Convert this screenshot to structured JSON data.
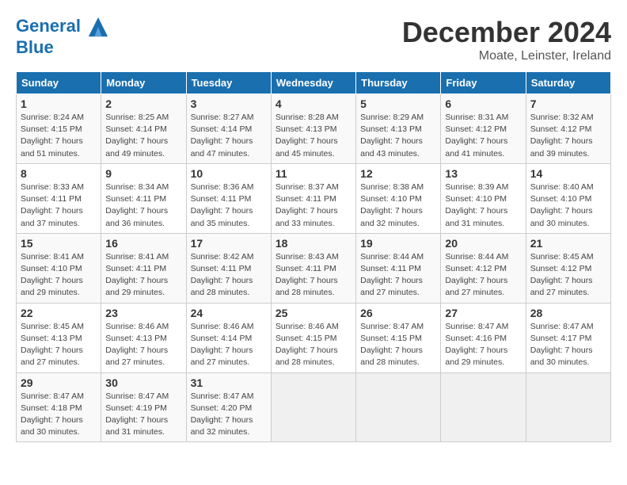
{
  "header": {
    "logo_line1": "General",
    "logo_line2": "Blue",
    "month": "December 2024",
    "location": "Moate, Leinster, Ireland"
  },
  "weekdays": [
    "Sunday",
    "Monday",
    "Tuesday",
    "Wednesday",
    "Thursday",
    "Friday",
    "Saturday"
  ],
  "weeks": [
    [
      {
        "day": "1",
        "info": "Sunrise: 8:24 AM\nSunset: 4:15 PM\nDaylight: 7 hours\nand 51 minutes."
      },
      {
        "day": "2",
        "info": "Sunrise: 8:25 AM\nSunset: 4:14 PM\nDaylight: 7 hours\nand 49 minutes."
      },
      {
        "day": "3",
        "info": "Sunrise: 8:27 AM\nSunset: 4:14 PM\nDaylight: 7 hours\nand 47 minutes."
      },
      {
        "day": "4",
        "info": "Sunrise: 8:28 AM\nSunset: 4:13 PM\nDaylight: 7 hours\nand 45 minutes."
      },
      {
        "day": "5",
        "info": "Sunrise: 8:29 AM\nSunset: 4:13 PM\nDaylight: 7 hours\nand 43 minutes."
      },
      {
        "day": "6",
        "info": "Sunrise: 8:31 AM\nSunset: 4:12 PM\nDaylight: 7 hours\nand 41 minutes."
      },
      {
        "day": "7",
        "info": "Sunrise: 8:32 AM\nSunset: 4:12 PM\nDaylight: 7 hours\nand 39 minutes."
      }
    ],
    [
      {
        "day": "8",
        "info": "Sunrise: 8:33 AM\nSunset: 4:11 PM\nDaylight: 7 hours\nand 37 minutes."
      },
      {
        "day": "9",
        "info": "Sunrise: 8:34 AM\nSunset: 4:11 PM\nDaylight: 7 hours\nand 36 minutes."
      },
      {
        "day": "10",
        "info": "Sunrise: 8:36 AM\nSunset: 4:11 PM\nDaylight: 7 hours\nand 35 minutes."
      },
      {
        "day": "11",
        "info": "Sunrise: 8:37 AM\nSunset: 4:11 PM\nDaylight: 7 hours\nand 33 minutes."
      },
      {
        "day": "12",
        "info": "Sunrise: 8:38 AM\nSunset: 4:10 PM\nDaylight: 7 hours\nand 32 minutes."
      },
      {
        "day": "13",
        "info": "Sunrise: 8:39 AM\nSunset: 4:10 PM\nDaylight: 7 hours\nand 31 minutes."
      },
      {
        "day": "14",
        "info": "Sunrise: 8:40 AM\nSunset: 4:10 PM\nDaylight: 7 hours\nand 30 minutes."
      }
    ],
    [
      {
        "day": "15",
        "info": "Sunrise: 8:41 AM\nSunset: 4:10 PM\nDaylight: 7 hours\nand 29 minutes."
      },
      {
        "day": "16",
        "info": "Sunrise: 8:41 AM\nSunset: 4:11 PM\nDaylight: 7 hours\nand 29 minutes."
      },
      {
        "day": "17",
        "info": "Sunrise: 8:42 AM\nSunset: 4:11 PM\nDaylight: 7 hours\nand 28 minutes."
      },
      {
        "day": "18",
        "info": "Sunrise: 8:43 AM\nSunset: 4:11 PM\nDaylight: 7 hours\nand 28 minutes."
      },
      {
        "day": "19",
        "info": "Sunrise: 8:44 AM\nSunset: 4:11 PM\nDaylight: 7 hours\nand 27 minutes."
      },
      {
        "day": "20",
        "info": "Sunrise: 8:44 AM\nSunset: 4:12 PM\nDaylight: 7 hours\nand 27 minutes."
      },
      {
        "day": "21",
        "info": "Sunrise: 8:45 AM\nSunset: 4:12 PM\nDaylight: 7 hours\nand 27 minutes."
      }
    ],
    [
      {
        "day": "22",
        "info": "Sunrise: 8:45 AM\nSunset: 4:13 PM\nDaylight: 7 hours\nand 27 minutes."
      },
      {
        "day": "23",
        "info": "Sunrise: 8:46 AM\nSunset: 4:13 PM\nDaylight: 7 hours\nand 27 minutes."
      },
      {
        "day": "24",
        "info": "Sunrise: 8:46 AM\nSunset: 4:14 PM\nDaylight: 7 hours\nand 27 minutes."
      },
      {
        "day": "25",
        "info": "Sunrise: 8:46 AM\nSunset: 4:15 PM\nDaylight: 7 hours\nand 28 minutes."
      },
      {
        "day": "26",
        "info": "Sunrise: 8:47 AM\nSunset: 4:15 PM\nDaylight: 7 hours\nand 28 minutes."
      },
      {
        "day": "27",
        "info": "Sunrise: 8:47 AM\nSunset: 4:16 PM\nDaylight: 7 hours\nand 29 minutes."
      },
      {
        "day": "28",
        "info": "Sunrise: 8:47 AM\nSunset: 4:17 PM\nDaylight: 7 hours\nand 30 minutes."
      }
    ],
    [
      {
        "day": "29",
        "info": "Sunrise: 8:47 AM\nSunset: 4:18 PM\nDaylight: 7 hours\nand 30 minutes."
      },
      {
        "day": "30",
        "info": "Sunrise: 8:47 AM\nSunset: 4:19 PM\nDaylight: 7 hours\nand 31 minutes."
      },
      {
        "day": "31",
        "info": "Sunrise: 8:47 AM\nSunset: 4:20 PM\nDaylight: 7 hours\nand 32 minutes."
      },
      {
        "day": "",
        "info": ""
      },
      {
        "day": "",
        "info": ""
      },
      {
        "day": "",
        "info": ""
      },
      {
        "day": "",
        "info": ""
      }
    ]
  ]
}
